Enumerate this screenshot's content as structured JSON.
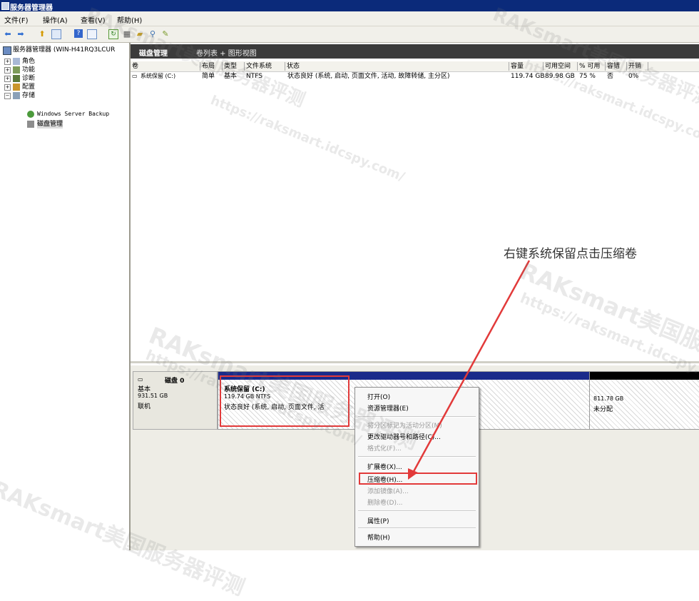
{
  "window": {
    "title": "服务器管理器"
  },
  "menu": [
    "文件(F)",
    "操作(A)",
    "查看(V)",
    "帮助(H)"
  ],
  "toolbar_icons": [
    "back-icon",
    "forward-icon",
    "up-icon",
    "show-tree-icon",
    "help-icon",
    "console-icon",
    "refresh-icon",
    "properties-icon",
    "open-icon",
    "search-icon",
    "wizard-icon"
  ],
  "tree": {
    "root": "服务器管理器 (WIN-H41RQ3LCUR",
    "items": [
      "角色",
      "功能",
      "诊断",
      "配置",
      "存储"
    ],
    "storage_children": [
      "Windows Server Backup",
      "磁盘管理"
    ]
  },
  "right_header": {
    "title": "磁盘管理",
    "views": "卷列表 + 图形视图"
  },
  "columns": [
    "卷",
    "布局",
    "类型",
    "文件系统",
    "状态",
    "容量",
    "可用空间",
    "% 可用",
    "容错",
    "开销"
  ],
  "volumes": [
    {
      "volume": "系统保留 (C:)",
      "layout": "简单",
      "type": "基本",
      "fs": "NTFS",
      "status": "状态良好 (系统, 启动, 页面文件, 活动, 故障转储, 主分区)",
      "capacity": "119.74 GB",
      "free": "89.98 GB",
      "pct_free": "75 %",
      "fault": "否",
      "overhead": "0%"
    }
  ],
  "disk": {
    "name": "磁盘 0",
    "type": "基本",
    "size": "931.51 GB",
    "state": "联机"
  },
  "partition_c": {
    "name": "系统保留 (C:)",
    "size": "119.74 GB NTFS",
    "status": "状态良好 (系统, 启动, 页面文件, 活"
  },
  "partition_unalloc": {
    "size": "811.78 GB",
    "label": "未分配"
  },
  "context_menu": {
    "open": "打开(O)",
    "explore": "资源管理器(E)",
    "mark_active": "将分区标记为活动分区(M)",
    "change_letter": "更改驱动器号和路径(C)...",
    "format": "格式化(F)...",
    "extend": "扩展卷(X)...",
    "shrink": "压缩卷(H)...",
    "add_mirror": "添加镜像(A)...",
    "delete": "删除卷(D)...",
    "properties": "属性(P)",
    "help": "帮助(H)"
  },
  "annotation": "右键系统保留点击压缩卷",
  "watermarks": [
    "RAKsmart美国服务器评测",
    "https://raksmart.idcspy.com/"
  ],
  "colors": {
    "accent_red": "#e23a3a",
    "partition_bar": "#1a2a8a",
    "unallocated_bar": "#000000"
  }
}
